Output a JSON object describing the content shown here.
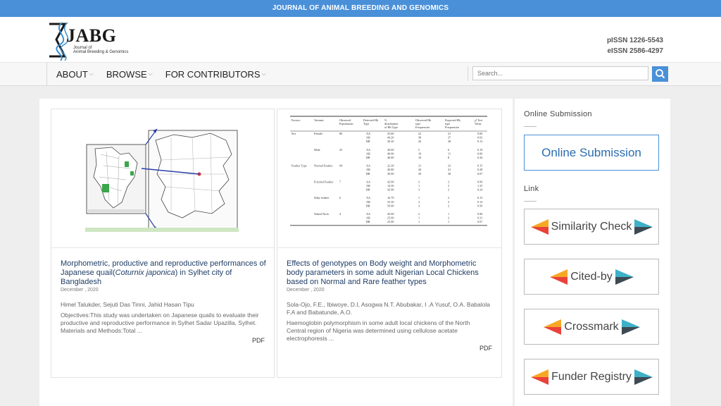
{
  "topbar": {
    "title": "JOURNAL OF ANIMAL BREEDING AND GENOMICS"
  },
  "logo": {
    "brand": "JABG",
    "sub1": "Journal of",
    "sub2": "Animal Breeding & Genomics"
  },
  "issn": {
    "print": "pISSN 1226-5543",
    "electronic": "eISSN 2586-4297"
  },
  "nav": {
    "about": "ABOUT",
    "browse": "BROWSE",
    "contributors": "FOR CONTRIBUTORS"
  },
  "search": {
    "placeholder": "Search..."
  },
  "articles": [
    {
      "title_a": "Morphometric, productive and reproductive performances of Japanese quail(",
      "title_italic": "Coturnix japonica",
      "title_b": ") in Sylhet city of Bangladesh",
      "date": "December , 2020",
      "authors": "Himel Talukder, Sejuti Das Tinni, Jahid Hasan Tipu",
      "abstract": "Objectives:This study was undertaken on Japanese quails to evaluate their productive and reproductive performance in Sylhet Sadar Upazilla, Sylhet. Materials and Methods:Total ...",
      "pdf": "PDF"
    },
    {
      "title": "Effects of genotypes on Body weight and Morphometric body parameters in some adult Nigerian Local Chickens based on Normal and Rare feather types",
      "date": "December , 2020",
      "authors": "Sola-Ojo, F.E., Ibiwoye, D.I, Asogwa N.T. Abubakar, I .A Yusuf, O.A. Babalola F.A and Babatunde, A.O.",
      "abstract": "Haemoglobin polymorphism in some adult local chickens of the North Central region of Nigeria was determined using cellulose acetate electrophoresis ...",
      "pdf": "PDF"
    }
  ],
  "table": {
    "headers": [
      "Factors",
      "Variants",
      "Observed Populations",
      "Detected Hb Type",
      "% distribution of Hb Type",
      "Observed Hb type Frequencies",
      "Expected Hb type Frequencies",
      "χ² Test Value"
    ],
    "rows": [
      [
        "Sex",
        "Female",
        "86",
        "AA",
        "25.60",
        "22",
        "21",
        "0.06"
      ],
      [
        "",
        "",
        "",
        "AB",
        "44.20",
        "38",
        "37",
        "0.02"
      ],
      [
        "",
        "",
        "",
        "BB",
        "30.20",
        "26",
        "28",
        "0.13"
      ],
      [
        "",
        "Male",
        "25",
        "AA",
        "20.00",
        "5",
        "6",
        "0.19"
      ],
      [
        "",
        "",
        "",
        "AB",
        "40.00",
        "10",
        "11",
        "0.06"
      ],
      [
        "",
        "",
        "",
        "BB",
        "40.00",
        "10",
        "8",
        "0.44"
      ],
      [
        "Feather Type",
        "Normal Feather",
        "94",
        "AA",
        "22.30",
        "21",
        "23",
        "0.15"
      ],
      [
        "",
        "",
        "",
        "AB",
        "46.80",
        "44",
        "41",
        "0.28"
      ],
      [
        "",
        "",
        "",
        "BB",
        "30.90",
        "29",
        "30",
        "0.07"
      ],
      [
        "",
        "Frizzled Feather",
        "7",
        "AA",
        "42.90",
        "3",
        "2",
        "0.99"
      ],
      [
        "",
        "",
        "",
        "AB",
        "14.30",
        "1",
        "3",
        "1.35"
      ],
      [
        "",
        "",
        "",
        "BB",
        "42.90",
        "3",
        "2",
        "0.24"
      ],
      [
        "",
        "Silky feather",
        "6",
        "AA",
        "16.70",
        "1",
        "2",
        "0.15"
      ],
      [
        "",
        "",
        "",
        "AB",
        "33.30",
        "2",
        "3",
        "0.14"
      ],
      [
        "",
        "",
        "",
        "BB",
        "50.00",
        "3",
        "2",
        "0.50"
      ],
      [
        "",
        "Naked Neck",
        "4",
        "AA",
        "45.00",
        "2",
        "1",
        "0.96"
      ],
      [
        "",
        "",
        "",
        "AB",
        "25.00",
        "1",
        "2",
        "0.31"
      ],
      [
        "",
        "",
        "",
        "BB",
        "25.00",
        "1",
        "1",
        "0.07"
      ]
    ]
  },
  "sidebar": {
    "online_heading": "Online Submission",
    "online_button": "Online Submission",
    "link_heading": "Link",
    "links": [
      "Similarity Check",
      "Cited-by",
      "Crossmark",
      "Funder Registry"
    ]
  },
  "colors": {
    "accent": "#4a90d9",
    "title": "#1f3d66",
    "crossref_orange": "#f7a823",
    "crossref_red": "#e9423b",
    "crossref_teal": "#3eb1c8",
    "crossref_dark": "#3d4a54"
  }
}
